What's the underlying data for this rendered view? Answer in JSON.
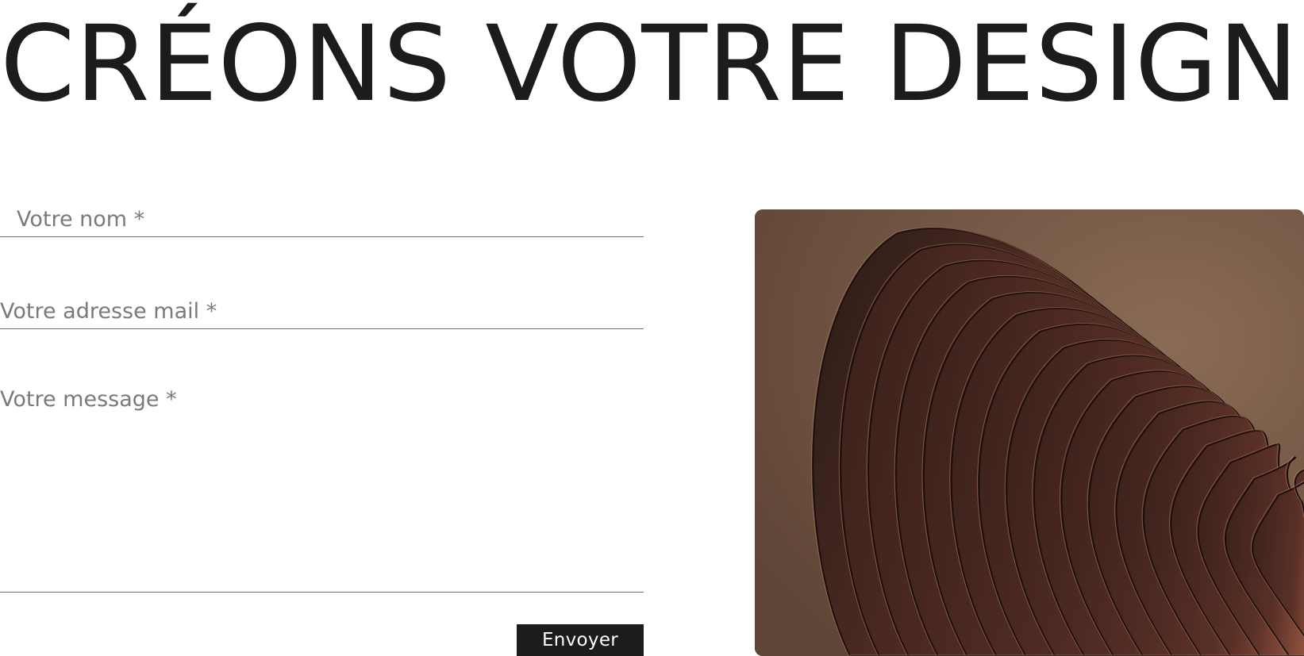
{
  "hero": {
    "title": "CRÉONS VOTRE DESIGN"
  },
  "form": {
    "name_placeholder": "Votre nom *",
    "email_placeholder": "Votre adresse mail *",
    "message_placeholder": "Votre message *",
    "submit_label": "Envoyer"
  },
  "colors": {
    "text": "#1c1c1c",
    "placeholder": "#7a7a7a",
    "divider": "#6f6f6f",
    "button_bg": "#1c1c1c",
    "button_text": "#ffffff",
    "art_background": "#6e5443",
    "art_shape": "#4a2a22"
  },
  "art": {
    "subject": "abstract-copper-curved-layers"
  }
}
